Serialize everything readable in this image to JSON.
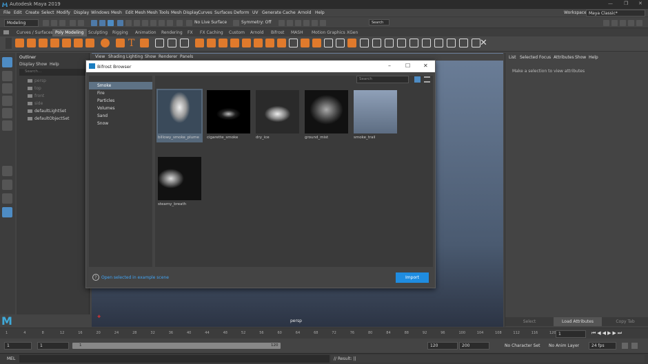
{
  "window": {
    "title": "Autodesk Maya 2019"
  },
  "menus": [
    "File",
    "Edit",
    "Create",
    "Select",
    "Modify",
    "Display",
    "Windows",
    "Mesh",
    "Edit Mesh",
    "Mesh Tools",
    "Mesh Display",
    "Curves",
    "Surfaces",
    "Deform",
    "UV",
    "Generate",
    "Cache",
    "Arnold",
    "Help"
  ],
  "workspace": {
    "label": "Workspace :",
    "value": "Maya Classic*"
  },
  "statusline": {
    "mode": "Modeling",
    "live_surface": "No Live Surface",
    "symmetry": "Symmetry: Off",
    "search": "Search"
  },
  "shelf_tabs": [
    "Curves / Surfaces",
    "Poly Modeling",
    "Sculpting",
    "Rigging",
    "Animation",
    "Rendering",
    "FX",
    "FX Caching",
    "Custom",
    "Arnold",
    "Bifrost",
    "MASH",
    "Motion Graphics",
    "XGen"
  ],
  "shelf_active_tab": "Poly Modeling",
  "outliner": {
    "title": "Outliner",
    "menu": [
      "Display",
      "Show",
      "Help"
    ],
    "search_placeholder": "Search...",
    "items": [
      {
        "label": "persp",
        "dim": true
      },
      {
        "label": "top",
        "dim": true
      },
      {
        "label": "front",
        "dim": true
      },
      {
        "label": "side",
        "dim": true
      },
      {
        "label": "defaultLightSet",
        "dim": false
      },
      {
        "label": "defaultObjectSet",
        "dim": false
      }
    ]
  },
  "viewport": {
    "menu": [
      "View",
      "Shading",
      "Lighting",
      "Show",
      "Renderer",
      "Panels"
    ],
    "camera_label": "persp"
  },
  "attribute_editor": {
    "menu": [
      "List",
      "Selected",
      "Focus",
      "Attributes",
      "Show",
      "Help"
    ],
    "message": "Make a selection to view attributes",
    "select_button": "Select",
    "load_button": "Load Attributes",
    "copy_button": "Copy Tab"
  },
  "dialog": {
    "title": "Bifrost Browser",
    "categories": [
      "Smoke",
      "Fire",
      "Particles",
      "Volumes",
      "Sand",
      "Snow"
    ],
    "active_category": "Smoke",
    "search_placeholder": "Search",
    "items": [
      {
        "label": "billowy_smoke_plume",
        "selected": true
      },
      {
        "label": "cigarette_smoke",
        "selected": false
      },
      {
        "label": "dry_ice",
        "selected": false
      },
      {
        "label": "ground_mist",
        "selected": false
      },
      {
        "label": "smoke_trail",
        "selected": false
      },
      {
        "label": "steamy_breath",
        "selected": false
      }
    ],
    "open_link": "Open selected in example scene",
    "import_button": "Import"
  },
  "timeline": {
    "ticks": [
      "1",
      "4",
      "8",
      "12",
      "16",
      "20",
      "24",
      "28",
      "32",
      "36",
      "40",
      "44",
      "48",
      "52",
      "56",
      "60",
      "64",
      "68",
      "72",
      "76",
      "80",
      "84",
      "88",
      "92",
      "96",
      "100",
      "104",
      "108",
      "112",
      "116",
      "120"
    ],
    "current_frame": "1"
  },
  "range": {
    "start": "1",
    "playback_start": "1",
    "slider_start": "1",
    "slider_end": "120",
    "playback_end": "120",
    "end": "200",
    "character_set": "No Character Set",
    "anim_layer": "No Anim Layer",
    "fps": "24 fps"
  },
  "command_line": {
    "language": "MEL",
    "result": "// Result: ||"
  },
  "colors": {
    "accent": "#1f8ce0",
    "selection": "#5e7285",
    "shelf_icon": "#e07a2c"
  }
}
